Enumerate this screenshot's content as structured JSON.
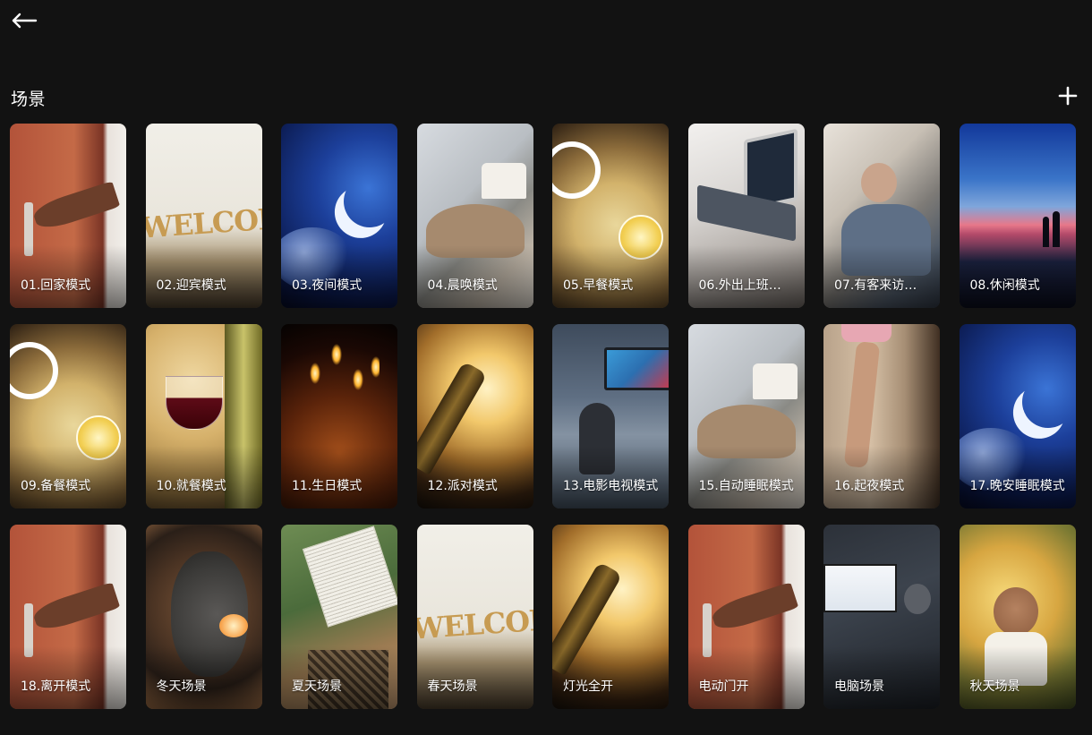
{
  "header": {
    "back_icon": "arrow-left-icon"
  },
  "section": {
    "title": "场景",
    "add_icon": "plus-icon"
  },
  "scenes": [
    {
      "label": "01.回家模式",
      "art": "door"
    },
    {
      "label": "02.迎宾模式",
      "art": "welcome"
    },
    {
      "label": "03.夜间模式",
      "art": "night"
    },
    {
      "label": "04.晨唤模式",
      "art": "bed"
    },
    {
      "label": "05.早餐模式",
      "art": "breakfast"
    },
    {
      "label": "06.外出上班…",
      "art": "laptop"
    },
    {
      "label": "07.有客来访…",
      "art": "guest"
    },
    {
      "label": "08.休闲模式",
      "art": "beach"
    },
    {
      "label": "09.备餐模式",
      "art": "breakfast"
    },
    {
      "label": "10.就餐模式",
      "art": "wine"
    },
    {
      "label": "11.生日模式",
      "art": "cake"
    },
    {
      "label": "12.派对模式",
      "art": "party"
    },
    {
      "label": "13.电影电视模式",
      "art": "tv"
    },
    {
      "label": "15.自动睡眠模式",
      "art": "bed"
    },
    {
      "label": "16.起夜模式",
      "art": "legs"
    },
    {
      "label": "17.晚安睡眠模式",
      "art": "night"
    },
    {
      "label": "18.离开模式",
      "art": "door"
    },
    {
      "label": "冬天场景",
      "art": "snow"
    },
    {
      "label": "夏天场景",
      "art": "read"
    },
    {
      "label": "春天场景",
      "art": "welcome"
    },
    {
      "label": "灯光全开",
      "art": "party"
    },
    {
      "label": "电动门开",
      "art": "door"
    },
    {
      "label": "电脑场景",
      "art": "meeting"
    },
    {
      "label": "秋天场景",
      "art": "kid"
    }
  ]
}
